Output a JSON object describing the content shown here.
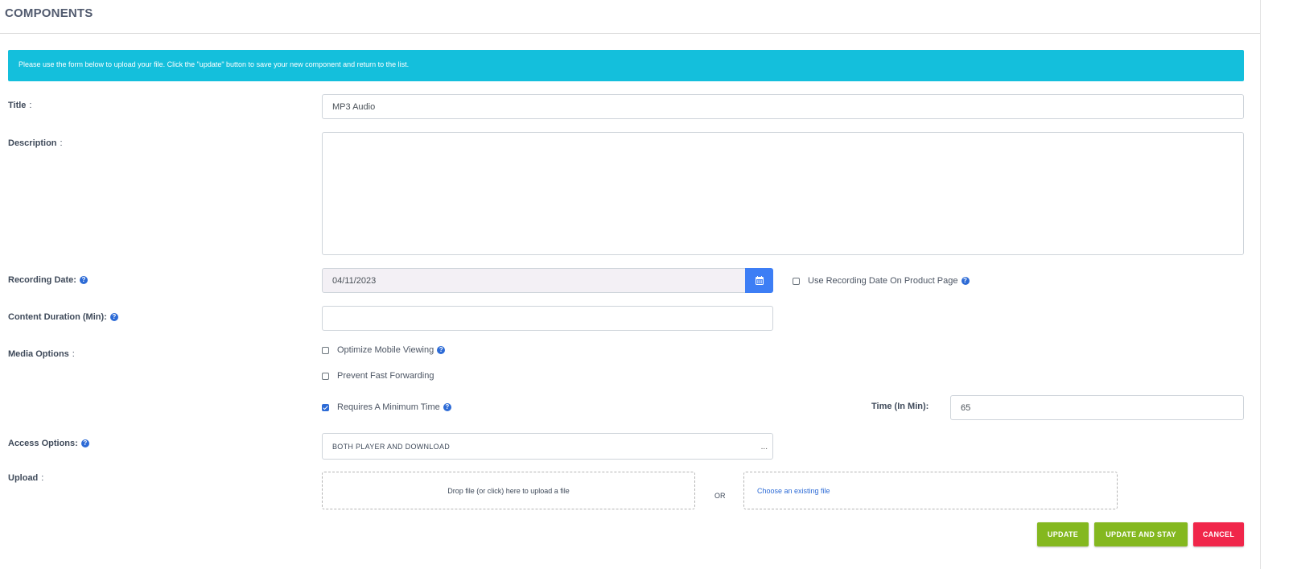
{
  "header": {
    "title": "COMPONENTS"
  },
  "alert": {
    "text": "Please use the form below to upload your file. Click the \"update\" button to save your new component and return to the list."
  },
  "form": {
    "title": {
      "label": "Title",
      "value": "MP3 Audio"
    },
    "description": {
      "label": "Description",
      "value": ""
    },
    "recording_date": {
      "label": "Recording Date:",
      "value": "04/11/2023",
      "icon": "calendar-icon"
    },
    "use_recording_date": {
      "label": "Use Recording Date On Product Page",
      "checked": false
    },
    "content_duration": {
      "label": "Content Duration (Min):",
      "value": ""
    },
    "media_options": {
      "label": "Media Options",
      "optimize_mobile": {
        "label": "Optimize Mobile Viewing",
        "checked": false
      },
      "prevent_fast_forward": {
        "label": "Prevent Fast Forwarding",
        "checked": false
      },
      "requires_min_time": {
        "label": "Requires A Minimum Time",
        "checked": true
      }
    },
    "time_in_min": {
      "label": "Time (In Min):",
      "value": "65"
    },
    "access_options": {
      "label": "Access Options:",
      "value": "BOTH PLAYER AND DOWNLOAD",
      "suffix": "..."
    },
    "upload": {
      "label": "Upload",
      "dropzone_text": "Drop file (or click) here to upload a file",
      "or_text": "OR",
      "existing_link": "Choose an existing file"
    }
  },
  "buttons": {
    "update": "UPDATE",
    "update_and_stay": "UPDATE AND STAY",
    "cancel": "CANCEL"
  },
  "colors": {
    "accent": "#14bfdc",
    "primary": "#3d7ef5",
    "success": "#84b81f",
    "danger": "#f0264a"
  }
}
